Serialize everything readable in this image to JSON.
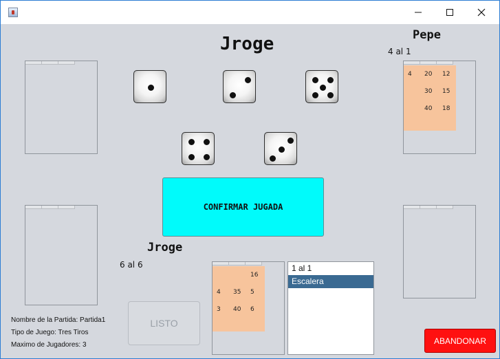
{
  "window": {
    "icon": "java-cup-icon",
    "controls": [
      "minimize-icon",
      "maximize-icon",
      "close-icon"
    ]
  },
  "main_title": "Jroge",
  "opponent": {
    "name": "Pepe",
    "selection": "4 al 1",
    "scores": [
      "4",
      "20",
      "12",
      "30",
      "15",
      "40",
      "18"
    ]
  },
  "current_player": {
    "name": "Jroge",
    "selection": "6 al 6",
    "scores": [
      "16",
      "4",
      "35",
      "5",
      "3",
      "40",
      "6"
    ]
  },
  "dice": [
    1,
    2,
    5,
    4,
    3
  ],
  "buttons": {
    "confirm": "CONFIRMAR JUGADA",
    "listo": "LISTO",
    "abandonar": "ABANDONAR"
  },
  "plays_list": {
    "items": [
      "1 al 1",
      "Escalera"
    ],
    "selected": "Escalera"
  },
  "game_info": {
    "name": "Nombre de la Partida: Partida1",
    "type": "Tipo de Juego: Tres Tiros",
    "max_players": "Maximo de Jugadores: 3"
  },
  "colors": {
    "background": "#d5d8de",
    "confirm": "#00fbfb",
    "abandonar": "#ff1010",
    "score_sheet": "#f7c49c",
    "list_selected": "#3a6a92"
  }
}
